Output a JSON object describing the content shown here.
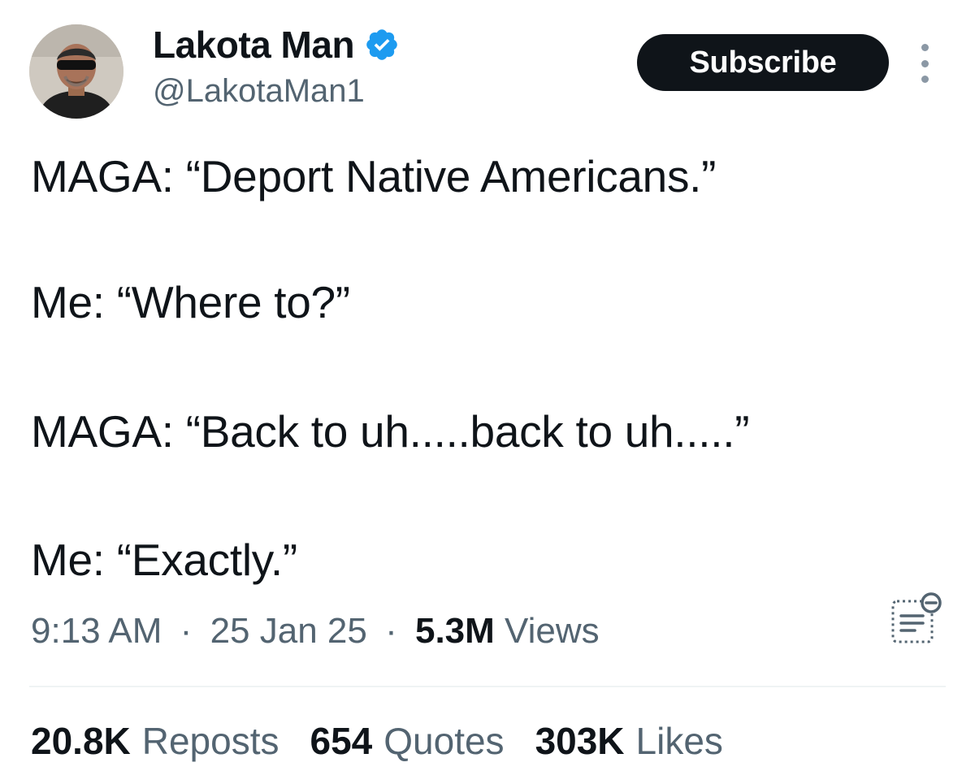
{
  "author": {
    "display_name": "Lakota Man",
    "handle": "@LakotaMan1",
    "verified": true,
    "verified_color": "#1d9bf0"
  },
  "header": {
    "subscribe_label": "Subscribe"
  },
  "tweet": {
    "lines": [
      "MAGA: “Deport Native Americans.”",
      "Me: “Where to?”",
      "MAGA: “Back to uh.....back to uh.....”",
      "Me: “Exactly.”"
    ]
  },
  "meta": {
    "time": "9:13 AM",
    "separator": "·",
    "date": "25 Jan 25",
    "views_count": "5.3M",
    "views_label": "Views"
  },
  "stats": {
    "reposts_count": "20.8K",
    "reposts_label": "Reposts",
    "quotes_count": "654",
    "quotes_label": "Quotes",
    "likes_count": "303K",
    "likes_label": "Likes"
  },
  "icons": {
    "more": "more-vertical-icon",
    "analytics": "post-analytics-icon",
    "verified": "verified-badge-icon"
  }
}
